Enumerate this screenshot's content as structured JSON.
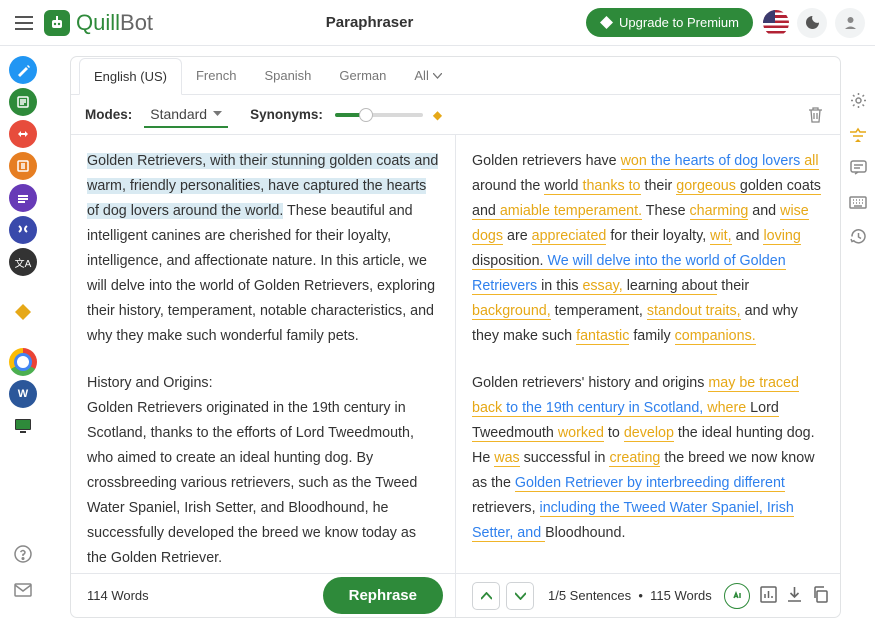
{
  "header": {
    "title": "Paraphraser",
    "upgrade_label": "Upgrade to Premium",
    "logo_main": "Quill",
    "logo_suffix": "Bot"
  },
  "lang_tabs": {
    "active": "English (US)",
    "items": [
      "French",
      "Spanish",
      "German",
      "All"
    ]
  },
  "modes": {
    "label": "Modes:",
    "current": "Standard",
    "syn_label": "Synonyms:"
  },
  "input": {
    "p1_hl": "Golden Retrievers, with their stunning golden coats and warm, friendly personalities, have captured the hearts of dog lovers around the world.",
    "p1_rest": " These beautiful and intelligent canines are cherished for their loyalty, intelligence, and affectionate nature. In this article, we will delve into the world of Golden Retrievers, exploring their history, temperament, notable characteristics, and why they make such wonderful family pets.",
    "p2_heading": "History and Origins:",
    "p2_body": "Golden Retrievers originated in the 19th century in Scotland, thanks to the efforts of Lord Tweedmouth, who aimed to create an ideal hunting dog. By crossbreeding various retrievers, such as the Tweed Water Spaniel, Irish Setter, and Bloodhound, he successfully developed the breed we know today as the Golden Retriever.",
    "word_count": "114 Words",
    "button": "Rephrase"
  },
  "output": {
    "sentences_label": "1/5 Sentences",
    "word_count": "115 Words",
    "t": {
      "s1a": "Golden retrievers have ",
      "s1b": "won",
      "s1c": " the hearts of dog lovers",
      "s1d": " all",
      "s1e": " around the ",
      "s1f": "world",
      "s1g": " thanks to",
      "s1h": " their ",
      "s1i": "gorgeous",
      "s1j": " golden coats and ",
      "s1k": "amiable temperament.",
      "s2a": " These ",
      "s2b": "charming",
      "s2c": " and ",
      "s2d": "wise dogs",
      "s2e": " are ",
      "s2f": "appreciated",
      "s2g": " for their loyalty, ",
      "s2h": "wit,",
      "s2i": " and ",
      "s2j": "loving",
      "s2k": " disposition.",
      "s3a": " We will delve into the world of Golden Retrievers",
      "s3b": " in this ",
      "s3c": "essay,",
      "s3d": " learning about",
      "s3e": " their ",
      "s3f": "background,",
      "s3g": " temperament, ",
      "s3h": "standout traits,",
      "s3i": " and why they make such ",
      "s3j": "fantastic",
      "s3k": " family ",
      "s3l": "companions.",
      "p2a": "Golden retrievers' history and origins ",
      "p2b": "may be traced back",
      "p2c": " to the 19th century in Scotland,",
      "p2d": " where",
      "p2e": " Lord Tweedmouth ",
      "p2f": "worked",
      "p2g": " to ",
      "p2h": "develop",
      "p2i": " the ideal hunting dog. He ",
      "p2j": "was",
      "p2k": " successful in ",
      "p2l": "creating",
      "p2m": " the breed we now know as the ",
      "p2n": "Golden Retriever by interbreeding different",
      "p2o": " retrievers, ",
      "p2p": "including the Tweed Water Spaniel, Irish Setter, and ",
      "p2q": "Bloodhound."
    }
  }
}
